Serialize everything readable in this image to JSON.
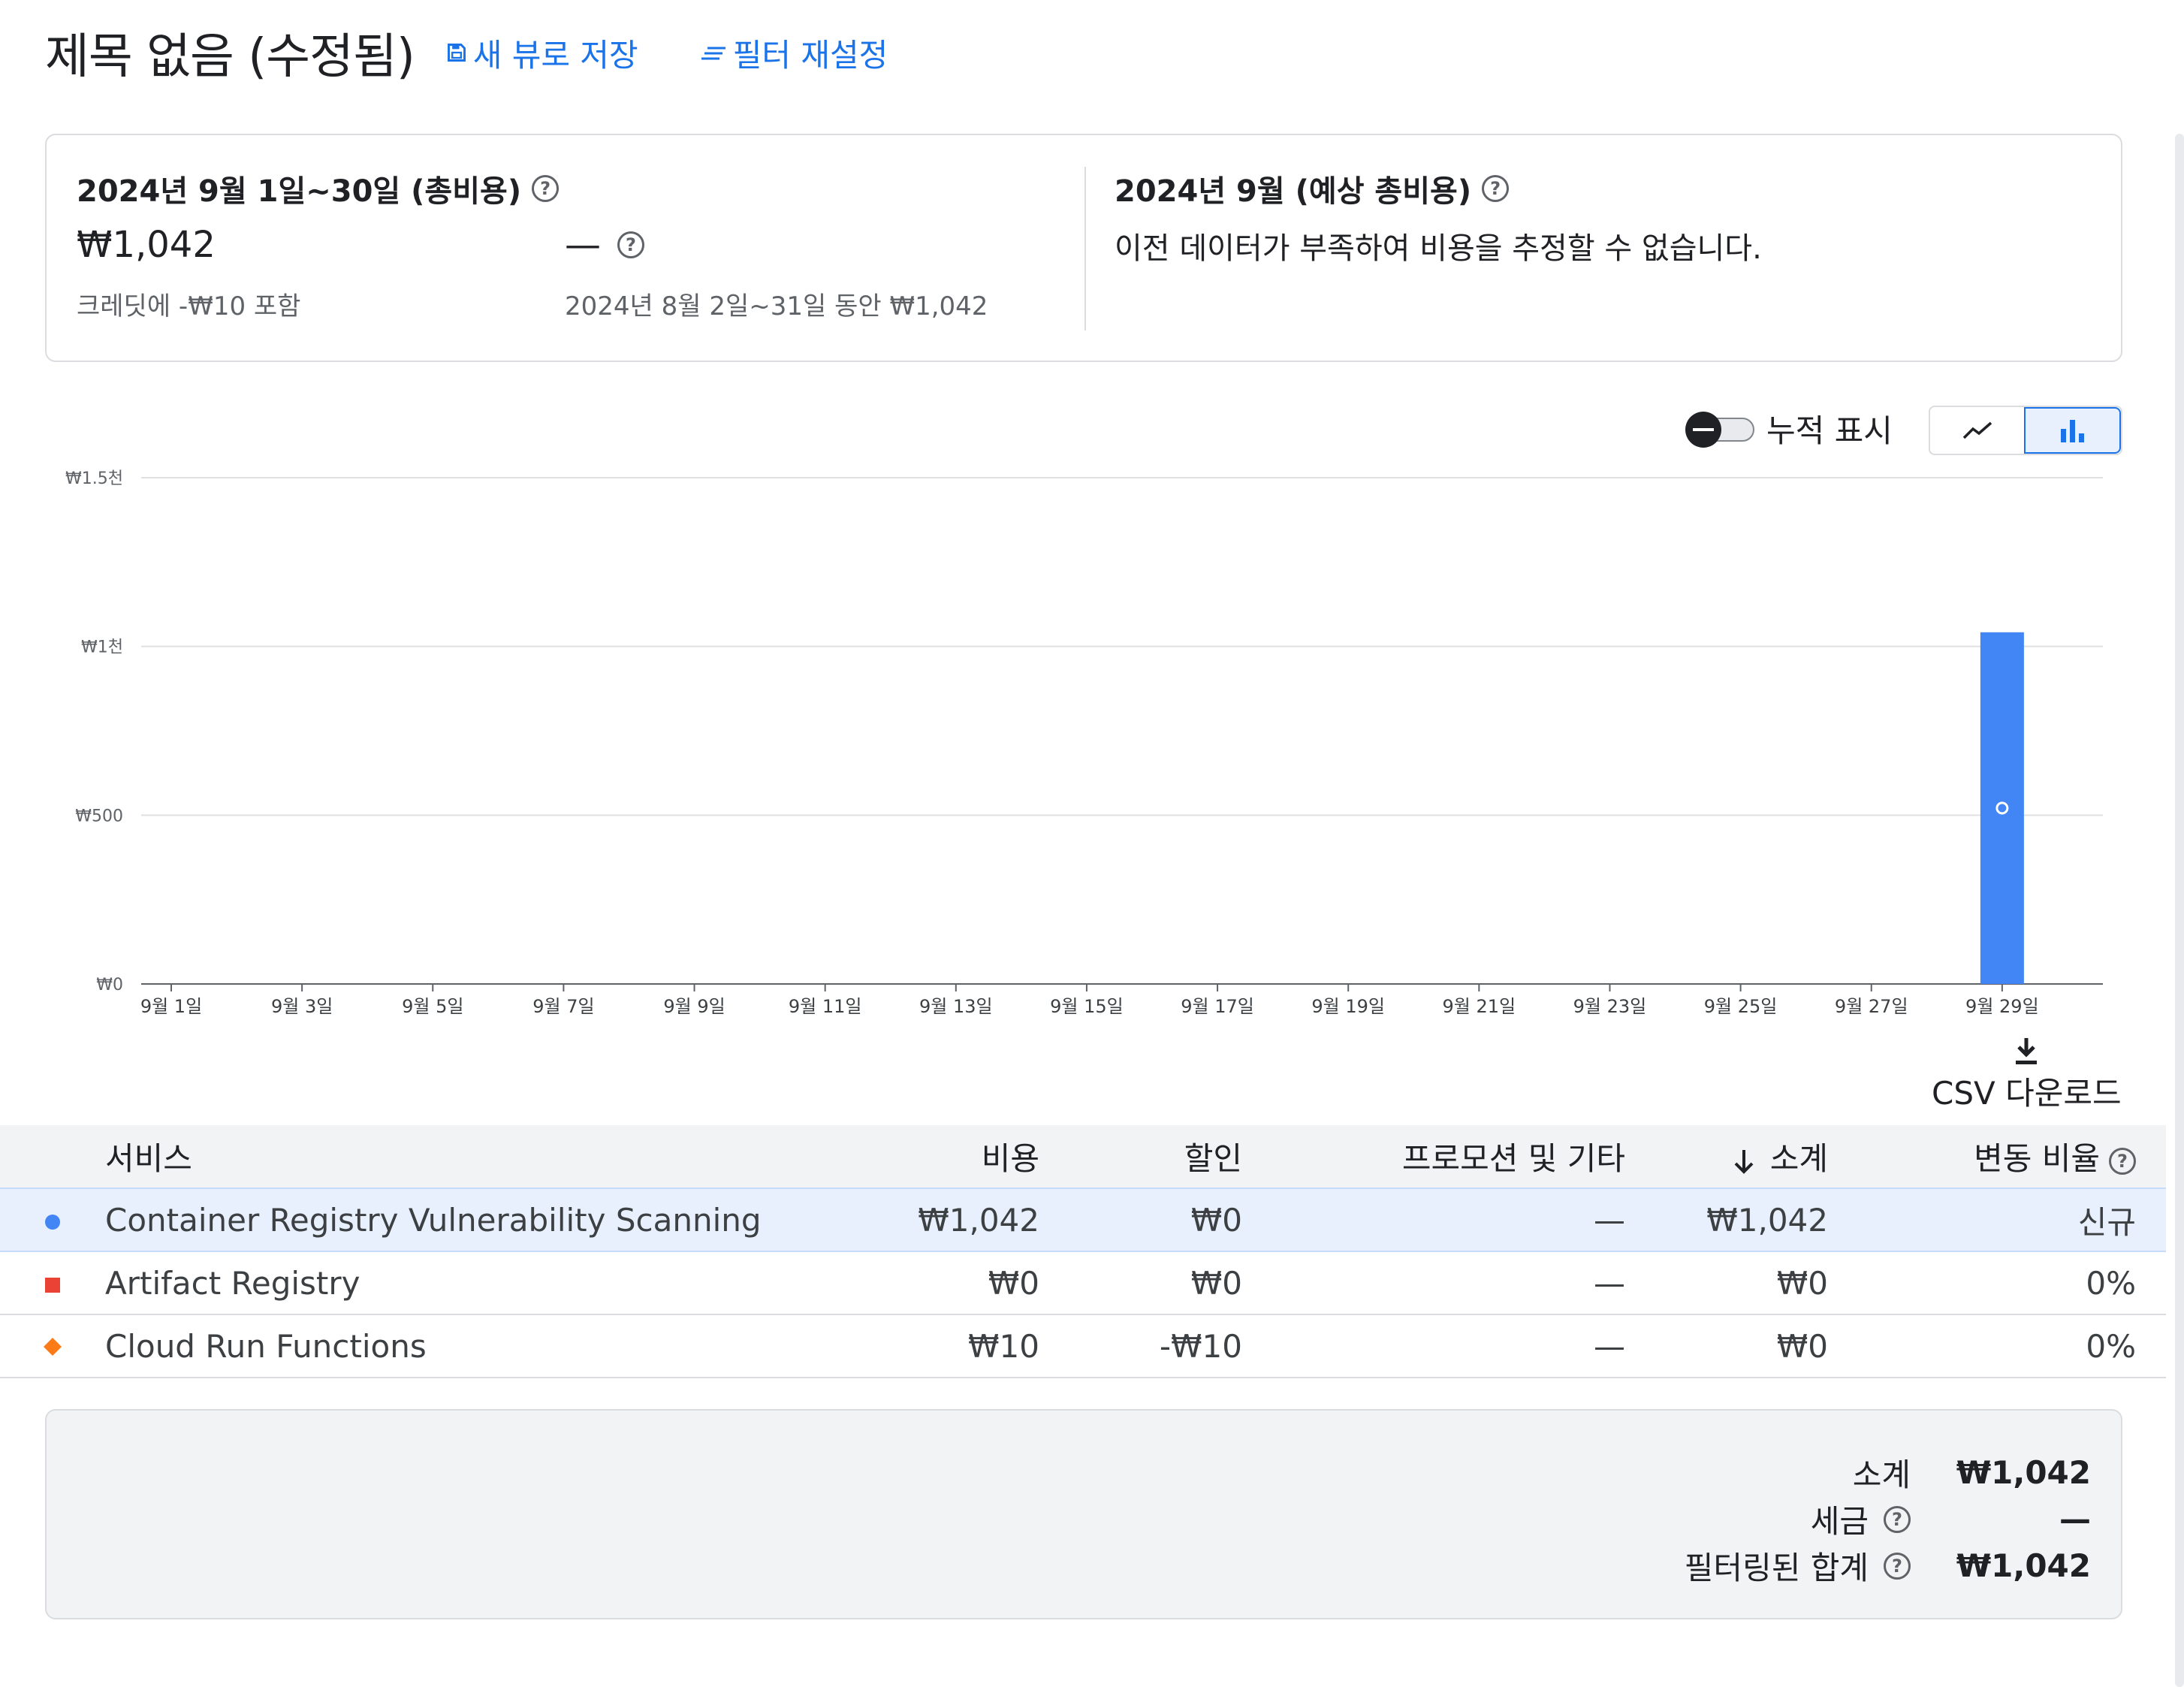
{
  "header": {
    "title": "제목 없음 (수정됨)",
    "save_view": "새 뷰로 저장",
    "reset_filter": "필터 재설정"
  },
  "summary": {
    "left": {
      "heading": "2024년 9월 1일~30일 (총비용)",
      "amount": "₩1,042",
      "credit_note": "크레딧에 -₩10 포함",
      "change": "—",
      "comparison": "2024년 8월 2일~31일 동안 ₩1,042"
    },
    "right": {
      "heading": "2024년 9월 (예상 총비용)",
      "message": "이전 데이터가 부족하여 비용을 추정할 수 없습니다."
    }
  },
  "controls": {
    "cumulative_label": "누적 표시",
    "cumulative_on": false,
    "chart_type_options": [
      "line",
      "bar"
    ],
    "chart_type_selected": "bar"
  },
  "chart_data": {
    "type": "bar",
    "categories": [
      "9월 1일",
      "9월 2일",
      "9월 3일",
      "9월 4일",
      "9월 5일",
      "9월 6일",
      "9월 7일",
      "9월 8일",
      "9월 9일",
      "9월 10일",
      "9월 11일",
      "9월 12일",
      "9월 13일",
      "9월 14일",
      "9월 15일",
      "9월 16일",
      "9월 17일",
      "9월 18일",
      "9월 19일",
      "9월 20일",
      "9월 21일",
      "9월 22일",
      "9월 23일",
      "9월 24일",
      "9월 25일",
      "9월 26일",
      "9월 27일",
      "9월 28일",
      "9월 29일",
      "9월 30일"
    ],
    "tick_labels": [
      "9월 1일",
      "9월 3일",
      "9월 5일",
      "9월 7일",
      "9월 9일",
      "9월 11일",
      "9월 13일",
      "9월 15일",
      "9월 17일",
      "9월 19일",
      "9월 21일",
      "9월 23일",
      "9월 25일",
      "9월 27일",
      "9월 29일"
    ],
    "series": [
      {
        "name": "Container Registry Vulnerability Scanning",
        "color": "#4285f4",
        "values": [
          0,
          0,
          0,
          0,
          0,
          0,
          0,
          0,
          0,
          0,
          0,
          0,
          0,
          0,
          0,
          0,
          0,
          0,
          0,
          0,
          0,
          0,
          0,
          0,
          0,
          0,
          0,
          0,
          1042,
          0
        ]
      }
    ],
    "ylim": [
      0,
      1500
    ],
    "y_ticks": [
      0,
      500,
      1000,
      1500
    ],
    "y_tick_labels": [
      "₩0",
      "₩500",
      "₩1천",
      "₩1.5천"
    ],
    "grid": true
  },
  "csv_download": "CSV 다운로드",
  "table": {
    "headers": {
      "service": "서비스",
      "cost": "비용",
      "discount": "할인",
      "promo": "프로모션 및 기타",
      "subtotal": "소계",
      "change": "변동 비율"
    },
    "rows": [
      {
        "marker": "circle",
        "color": "#4285f4",
        "service": "Container Registry Vulnerability Scanning",
        "cost": "₩1,042",
        "discount": "₩0",
        "promo": "—",
        "subtotal": "₩1,042",
        "change": "신규"
      },
      {
        "marker": "square",
        "color": "#ea4335",
        "service": "Artifact Registry",
        "cost": "₩0",
        "discount": "₩0",
        "promo": "—",
        "subtotal": "₩0",
        "change": "0%"
      },
      {
        "marker": "diamond",
        "color": "#fa7b17",
        "service": "Cloud Run Functions",
        "cost": "₩10",
        "discount": "-₩10",
        "promo": "—",
        "subtotal": "₩0",
        "change": "0%"
      }
    ]
  },
  "totals": {
    "subtotal_label": "소계",
    "subtotal_value": "₩1,042",
    "tax_label": "세금",
    "tax_value": "—",
    "filtered_total_label": "필터링된 합계",
    "filtered_total_value": "₩1,042"
  }
}
